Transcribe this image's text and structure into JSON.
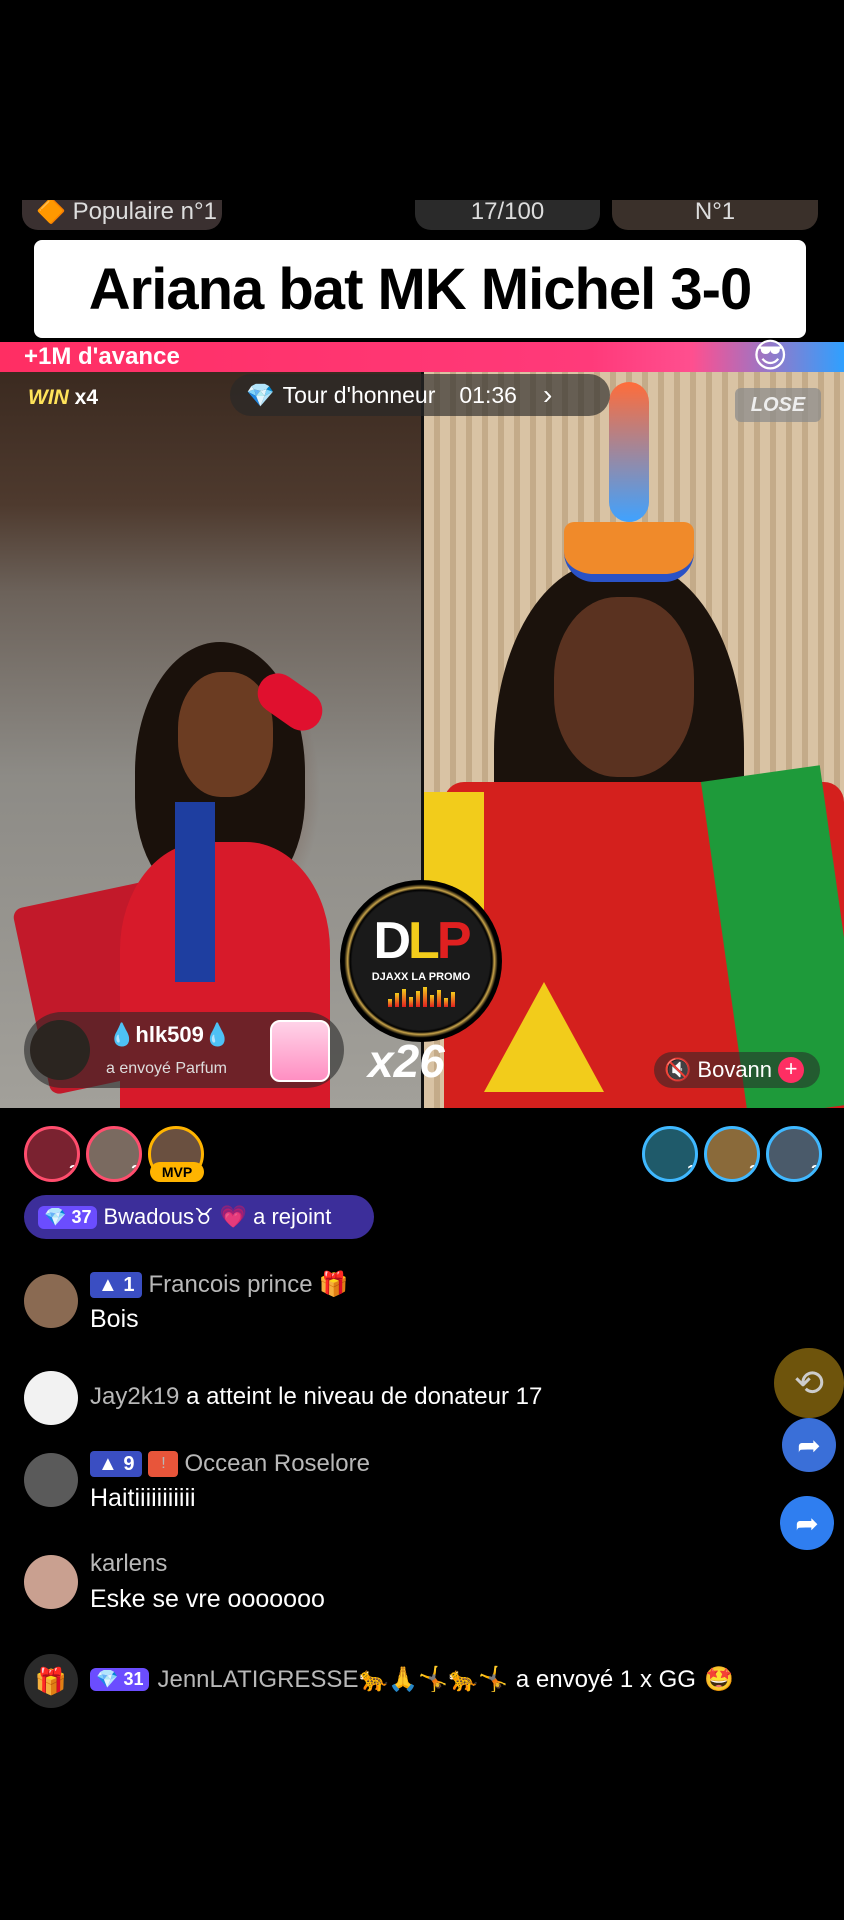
{
  "top_strip": {
    "left_label": "Populaire n°1",
    "mid_label": "17/100",
    "right_label": "N°1"
  },
  "caption": "Ariana bat MK Michel 3-0",
  "score_bar": {
    "lead_text": "+1M d'avance",
    "emoji": "😎"
  },
  "battle": {
    "win_label": "WIN",
    "win_count": "x4",
    "tour_label": "Tour d'honneur",
    "tour_timer": "01:36",
    "lose_label": "LOSE"
  },
  "gift": {
    "username": "💧hlk509💧",
    "action": "a envoyé  Parfum",
    "combo": "x26"
  },
  "right_host": {
    "name": "Bovann"
  },
  "logo": {
    "letters": [
      "D",
      "L",
      "P"
    ],
    "subtitle": "DJAXX LA PROMO"
  },
  "ranking": {
    "left": [
      {
        "rank": "3"
      },
      {
        "rank": "2"
      },
      {
        "badge": "MVP"
      }
    ],
    "right": [
      {
        "rank": "1"
      },
      {
        "rank": "2"
      },
      {
        "rank": "3"
      }
    ]
  },
  "chat": {
    "join": {
      "level": "37",
      "user": "Bwadous♉",
      "heart": "💗",
      "text": "a rejoint"
    },
    "messages": [
      {
        "level": "1",
        "user": "Francois  prince",
        "text": "Bois"
      },
      {
        "system": "Jay2k19",
        "text": "a atteint le niveau de donateur 17"
      },
      {
        "level": "9",
        "user": "Occean Roselore",
        "text": "Haitiiiiiiiiiii"
      },
      {
        "user": "karlens",
        "text": "Eske se vre ooooooo"
      }
    ],
    "gift_line": {
      "level": "31",
      "user": "JennLATIGRESSE🐆🙏🤸🐆🤸",
      "text": "a envoyé 1 x GG",
      "emoji": "🤩"
    }
  },
  "icons": [
    "diamond-icon",
    "chevron-right-icon",
    "mute-icon",
    "plus-icon",
    "gift-icon",
    "share-icon",
    "repost-icon",
    "crown-icon"
  ],
  "colors": {
    "battle_pink": "#ff2e63",
    "battle_blue": "#2fa0ff",
    "join_purple": "#3c2e9a",
    "mvp_gold": "#ffb400"
  }
}
